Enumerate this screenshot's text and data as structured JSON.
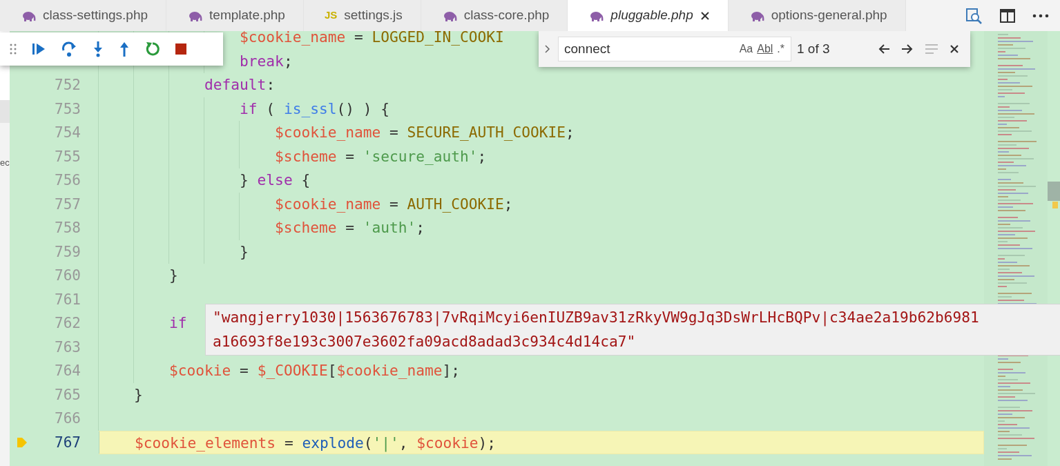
{
  "tabs": [
    {
      "label": "class-settings.php",
      "kind": "php",
      "selected": false,
      "preview": false
    },
    {
      "label": "template.php",
      "kind": "php",
      "selected": false,
      "preview": false
    },
    {
      "label": "settings.js",
      "kind": "js",
      "icon_label": "JS",
      "selected": false,
      "preview": false
    },
    {
      "label": "class-core.php",
      "kind": "php",
      "selected": false,
      "preview": false
    },
    {
      "label": "pluggable.php",
      "kind": "php",
      "selected": true,
      "preview": true
    },
    {
      "label": "options-general.php",
      "kind": "php",
      "selected": false,
      "preview": false
    }
  ],
  "sidebar_fragment": "ec",
  "find_widget": {
    "value": "connect",
    "options": [
      "Aa",
      "Abl",
      ".*"
    ],
    "result": "1 of 3"
  },
  "lines": [
    {
      "current": false,
      "tokens": [
        {
          "text": "                $cookie_name",
          "kind": "variable"
        },
        {
          "text": " = ",
          "kind": "plain"
        },
        {
          "text": "LOGGED_IN_COOKI",
          "kind": "constant"
        }
      ]
    },
    {
      "current": false,
      "tokens": [
        {
          "text": "                break",
          "kind": "keyword"
        },
        {
          "text": ";",
          "kind": "plain"
        }
      ]
    },
    {
      "number": "752",
      "current": false,
      "tokens": [
        {
          "text": "            default",
          "kind": "keyword"
        },
        {
          "text": ":",
          "kind": "plain"
        }
      ]
    },
    {
      "number": "753",
      "current": false,
      "tokens": [
        {
          "text": "                if",
          "kind": "keyword"
        },
        {
          "text": " ( ",
          "kind": "plain"
        },
        {
          "text": "is_ssl",
          "kind": "function"
        },
        {
          "text": "() ) {",
          "kind": "plain"
        }
      ]
    },
    {
      "number": "754",
      "current": false,
      "tokens": [
        {
          "text": "                    $cookie_name",
          "kind": "variable"
        },
        {
          "text": " = ",
          "kind": "plain"
        },
        {
          "text": "SECURE_AUTH_COOKIE",
          "kind": "constant"
        },
        {
          "text": ";",
          "kind": "plain"
        }
      ]
    },
    {
      "number": "755",
      "current": false,
      "tokens": [
        {
          "text": "                    $scheme",
          "kind": "variable"
        },
        {
          "text": " = ",
          "kind": "plain"
        },
        {
          "text": "'secure_auth'",
          "kind": "string"
        },
        {
          "text": ";",
          "kind": "plain"
        }
      ]
    },
    {
      "number": "756",
      "current": false,
      "tokens": [
        {
          "text": "                } ",
          "kind": "plain"
        },
        {
          "text": "else",
          "kind": "keyword"
        },
        {
          "text": " {",
          "kind": "plain"
        }
      ]
    },
    {
      "number": "757",
      "current": false,
      "tokens": [
        {
          "text": "                    $cookie_name",
          "kind": "variable"
        },
        {
          "text": " = ",
          "kind": "plain"
        },
        {
          "text": "AUTH_COOKIE",
          "kind": "constant"
        },
        {
          "text": ";",
          "kind": "plain"
        }
      ]
    },
    {
      "number": "758",
      "current": false,
      "tokens": [
        {
          "text": "                    $scheme",
          "kind": "variable"
        },
        {
          "text": " = ",
          "kind": "plain"
        },
        {
          "text": "'auth'",
          "kind": "string"
        },
        {
          "text": ";",
          "kind": "plain"
        }
      ]
    },
    {
      "number": "759",
      "current": false,
      "tokens": [
        {
          "text": "                }",
          "kind": "plain"
        }
      ]
    },
    {
      "number": "760",
      "current": false,
      "tokens": [
        {
          "text": "        }",
          "kind": "plain"
        }
      ]
    },
    {
      "number": "761",
      "current": false
    },
    {
      "number": "762",
      "current": false,
      "tokens": [
        {
          "text": "        if",
          "kind": "keyword"
        }
      ]
    },
    {
      "number": "763",
      "current": false
    },
    {
      "number": "764",
      "current": false,
      "tokens": [
        {
          "text": "        $cookie",
          "kind": "variable"
        },
        {
          "text": " = ",
          "kind": "plain"
        },
        {
          "text": "$_COOKIE",
          "kind": "variable"
        },
        {
          "text": "[",
          "kind": "plain"
        },
        {
          "text": "$cookie_name",
          "kind": "variable"
        },
        {
          "text": "];",
          "kind": "plain"
        }
      ]
    },
    {
      "number": "765",
      "current": false,
      "tokens": [
        {
          "text": "    }",
          "kind": "plain"
        }
      ]
    },
    {
      "number": "766",
      "current": false
    },
    {
      "number": "767",
      "current": true,
      "tokens": [
        {
          "text": "    $cookie_elements",
          "kind": "variable"
        },
        {
          "text": " = ",
          "kind": "plain"
        },
        {
          "text": "explode",
          "kind": "builtin"
        },
        {
          "text": "(",
          "kind": "plain"
        },
        {
          "text": "'|'",
          "kind": "string"
        },
        {
          "text": ", ",
          "kind": "plain"
        },
        {
          "text": "$cookie",
          "kind": "variable"
        },
        {
          "text": ");",
          "kind": "plain"
        }
      ]
    }
  ],
  "hover": {
    "lines": [
      "\"wangjerry1030|1563676783|7vRqiMcyi6enIUZB9av31zRkyVW9gJq3DsWrLHcBQPv|c34ae2a19b62b6981",
      "a16693f8e193c3007e3602fa09acd8adad3c934c4d14ca7\""
    ]
  }
}
